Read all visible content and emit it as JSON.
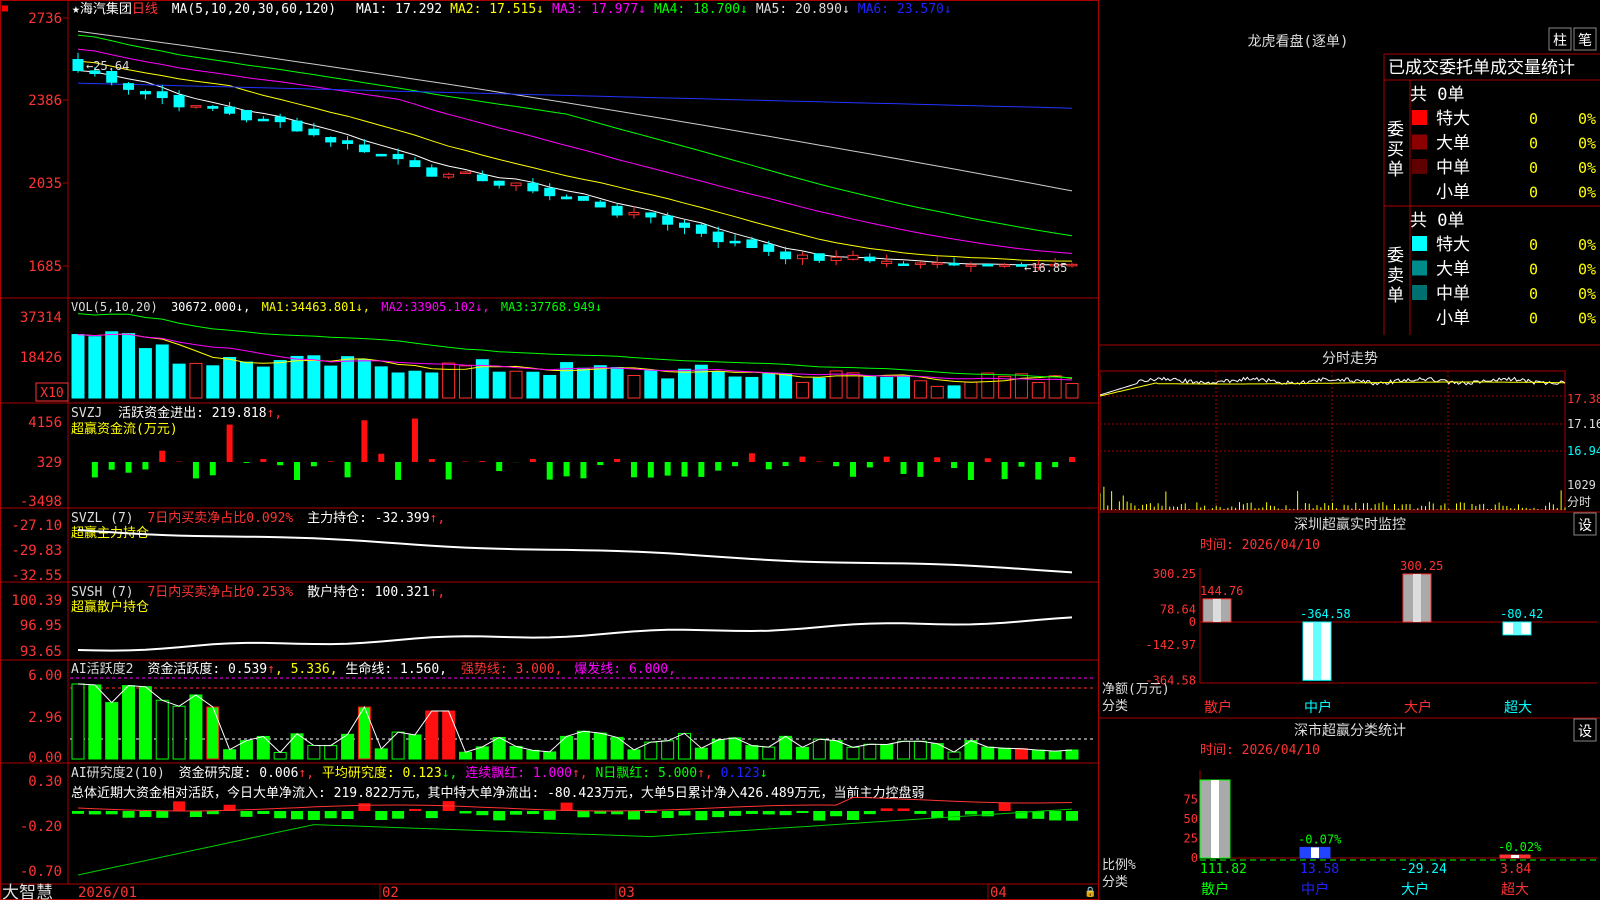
{
  "stock": {
    "star": "★",
    "name": "海汽集团",
    "period": "日线",
    "ma_label": "MA(5,10,20,30,60,120)",
    "ma_values": [
      {
        "label": "MA1:",
        "value": "17.292",
        "color": "#ffffff",
        "arrow": ""
      },
      {
        "label": "MA2:",
        "value": "17.515",
        "color": "#ffff00",
        "arrow": "↓"
      },
      {
        "label": "MA3:",
        "value": "17.977",
        "color": "#ff00ff",
        "arrow": "↓"
      },
      {
        "label": "MA4:",
        "value": "18.700",
        "color": "#00ff00",
        "arrow": "↓"
      },
      {
        "label": "MA5:",
        "value": "20.890",
        "color": "#dddddd",
        "arrow": "↓"
      },
      {
        "label": "MA6:",
        "value": "23.570",
        "color": "#2222ff",
        "arrow": "↓"
      }
    ],
    "high_mark": "25.64",
    "low_mark": "16.85"
  },
  "price_axis": [
    "2736",
    "2386",
    "2035",
    "1685"
  ],
  "vol": {
    "label": "VOL(5,10,20)",
    "value": "30672.000↓,",
    "ma": [
      {
        "label": "MA1:",
        "value": "34463.801↓,",
        "color": "#ffff00"
      },
      {
        "label": "MA2:",
        "value": "33905.102↓,",
        "color": "#ff00ff"
      },
      {
        "label": "MA3:",
        "value": "37768.949↓",
        "color": "#00ff00"
      }
    ],
    "axis": [
      "37314",
      "18426"
    ],
    "unit": "X10"
  },
  "svzj": {
    "label": "SVZJ",
    "text": "活跃资金进出: 219.818",
    "arrow": "↑,",
    "sub": "超赢资金流(万元)",
    "axis": [
      "4156",
      "329",
      "-3498"
    ]
  },
  "svzl": {
    "label": "SVZL (7)",
    "ratio": "7日内买卖净占比0.092%",
    "text": "主力持仓: -32.399",
    "arrow": "↑,",
    "sub": "超赢主力持仓",
    "axis": [
      "-27.10",
      "-29.83",
      "-32.55"
    ]
  },
  "svsh": {
    "label": "SVSH (7)",
    "ratio": "7日内买卖净占比0.253%",
    "text": "散户持仓: 100.321",
    "arrow": "↑,",
    "sub": "超赢散户持仓",
    "axis": [
      "100.39",
      "96.95",
      "93.65"
    ]
  },
  "ai_active": {
    "label": "AI活跃度2",
    "t1": "资金活跃度: 0.539",
    "t2": ", 5.336, ",
    "t3": "生命线: 1.560,",
    "t4": "强势线: 3.000,",
    "t5": "爆发线: 6.000,",
    "axis": [
      "6.00",
      "2.96",
      "0.00"
    ]
  },
  "ai_research": {
    "label": "AI研究度2(10)",
    "t1": "资金研究度: 0.006",
    "t2": "平均研究度: 0.123",
    "t3": "连续飘红: 1.000",
    "t4": "N日飘红: 5.000",
    "t5": "0.123",
    "summary": "总体近期大资金相对活跃，今日大单净流入: 219.822万元，其中特大单净流出: -80.423万元，大单5日累计净入426.489万元，当前主力控盘弱",
    "axis": [
      "0.30",
      "-0.20",
      "-0.70"
    ]
  },
  "date_axis": [
    "2026/01",
    "02",
    "03",
    "04"
  ],
  "brand": "大智慧",
  "right": {
    "dragon_title": "龙虎看盘(逐单)",
    "btn_zhu": "柱",
    "btn_bi": "笔",
    "header": "已成交委托单成交量统计",
    "buy": {
      "side": "委买单",
      "total": "共 0单",
      "rows": [
        {
          "label": "特大",
          "count": "0",
          "pct": "0%",
          "color": "#ff0000"
        },
        {
          "label": "大单",
          "count": "0",
          "pct": "0%",
          "color": "#8b0000"
        },
        {
          "label": "中单",
          "count": "0",
          "pct": "0%",
          "color": "#600000"
        },
        {
          "label": "小单",
          "count": "0",
          "pct": "0%",
          "color": "#000000"
        }
      ]
    },
    "sell": {
      "side": "委卖单",
      "total": "共 0单",
      "rows": [
        {
          "label": "特大",
          "count": "0",
          "pct": "0%",
          "color": "#00ffff"
        },
        {
          "label": "大单",
          "count": "0",
          "pct": "0%",
          "color": "#008b8b"
        },
        {
          "label": "中单",
          "count": "0",
          "pct": "0%",
          "color": "#006f6f"
        },
        {
          "label": "小单",
          "count": "0",
          "pct": "0%",
          "color": "#000000"
        }
      ]
    },
    "intraday_title": "分时走势",
    "intraday_axis": [
      "17.38",
      "17.16",
      "16.94",
      "1029"
    ],
    "intraday_unit": "分时",
    "sz_monitor": {
      "title": "深圳超赢实时监控",
      "btn": "设",
      "time": "时间: 2026/04/10",
      "ylabel": "净额(万元)",
      "xlabel": "分类",
      "axis": [
        "300.25",
        "78.64",
        "0",
        "-142.97",
        "-364.58"
      ]
    },
    "sz_class": {
      "title": "深市超赢分类统计",
      "btn": "设",
      "time": "时间: 2026/04/10",
      "ylabel": "比例%",
      "xlabel": "分类",
      "axis": [
        "75",
        "50",
        "25",
        "0"
      ]
    }
  },
  "chart_data": [
    {
      "type": "bar",
      "title": "深圳超赢实时监控",
      "ylabel": "净额(万元)",
      "xlabel": "分类",
      "categories": [
        "散户",
        "中户",
        "大户",
        "超大"
      ],
      "values": [
        144.76,
        -364.58,
        300.25,
        -80.42
      ],
      "ylim": [
        -364.58,
        300.25
      ]
    },
    {
      "type": "bar",
      "title": "深市超赢分类统计",
      "ylabel": "比例%",
      "xlabel": "分类",
      "categories": [
        "散户",
        "中户",
        "大户",
        "超大"
      ],
      "values": [
        111.82,
        13.58,
        -29.24,
        3.84
      ],
      "deltas": [
        "",
        "-0.07%",
        "",
        "-0.02%"
      ],
      "ylim": [
        0,
        100
      ]
    }
  ],
  "colors": {
    "up": "#ff3030",
    "down": "#00ffff",
    "frame": "#aa0000"
  }
}
